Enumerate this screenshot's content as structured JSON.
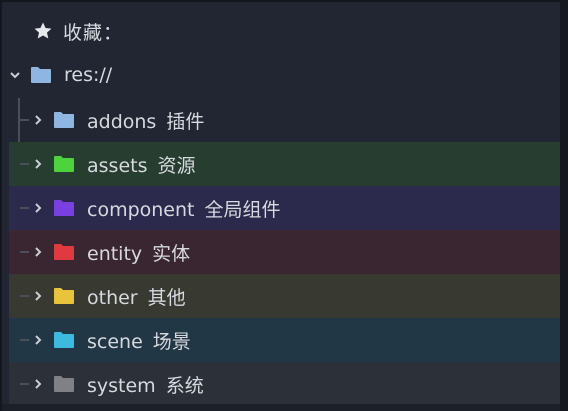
{
  "favorites": {
    "label": "收藏："
  },
  "root": {
    "label": "res://",
    "folder_color": "#8fb6e0"
  },
  "folders": [
    {
      "name": "addons",
      "desc": "插件",
      "color": "#8fb6e0",
      "row_bg": ""
    },
    {
      "name": "assets",
      "desc": "资源",
      "color": "#4fd33c",
      "row_bg": "#263d30"
    },
    {
      "name": "component",
      "desc": "全局组件",
      "color": "#7a3fe0",
      "row_bg": "#2c2a4c"
    },
    {
      "name": "entity",
      "desc": "实体",
      "color": "#e0393f",
      "row_bg": "#3a2631"
    },
    {
      "name": "other",
      "desc": "其他",
      "color": "#e9c43b",
      "row_bg": "#383930"
    },
    {
      "name": "scene",
      "desc": "场景",
      "color": "#3cbbdf",
      "row_bg": "#223745"
    },
    {
      "name": "system",
      "desc": "系统",
      "color": "#7f8187",
      "row_bg": "#2c3039"
    }
  ]
}
